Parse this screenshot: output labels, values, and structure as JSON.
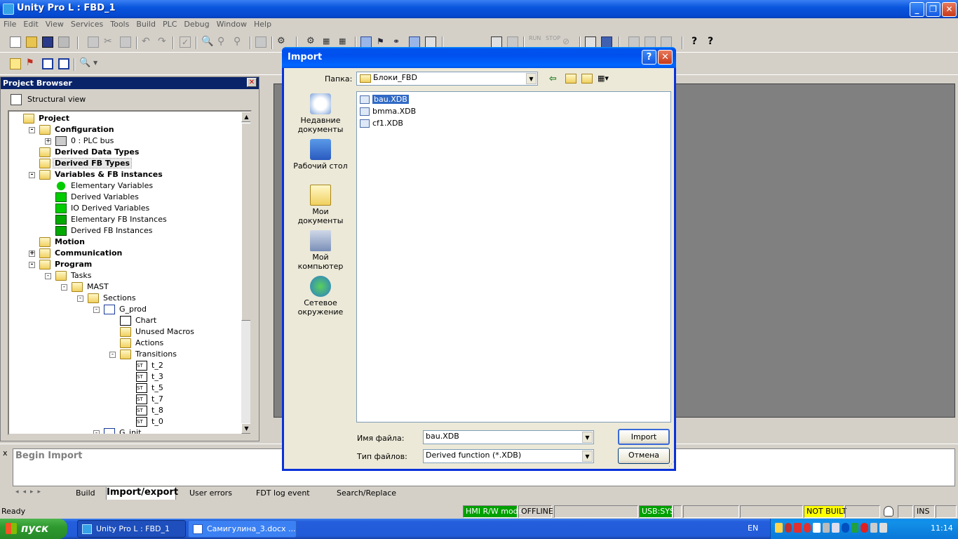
{
  "window": {
    "title": "Unity Pro L : FBD_1"
  },
  "menu": [
    "File",
    "Edit",
    "View",
    "Services",
    "Tools",
    "Build",
    "PLC",
    "Debug",
    "Window",
    "Help"
  ],
  "project_browser": {
    "title": "Project Browser",
    "view_label": "Structural view",
    "tree": [
      {
        "label": "Project",
        "bold": true
      },
      {
        "label": "Configuration",
        "bold": true
      },
      {
        "label": "0 : PLC bus",
        "bold": false
      },
      {
        "label": "Derived Data Types",
        "bold": true
      },
      {
        "label": "Derived FB Types",
        "bold": true
      },
      {
        "label": "Variables & FB instances",
        "bold": true
      },
      {
        "label": "Elementary Variables",
        "bold": false
      },
      {
        "label": "Derived Variables",
        "bold": false
      },
      {
        "label": "IO Derived Variables",
        "bold": false
      },
      {
        "label": "Elementary FB Instances",
        "bold": false
      },
      {
        "label": "Derived FB Instances",
        "bold": false
      },
      {
        "label": "Motion",
        "bold": true
      },
      {
        "label": "Communication",
        "bold": true
      },
      {
        "label": "Program",
        "bold": true
      },
      {
        "label": "Tasks",
        "bold": false
      },
      {
        "label": "MAST",
        "bold": false
      },
      {
        "label": "Sections",
        "bold": false
      },
      {
        "label": "G_prod",
        "bold": false
      },
      {
        "label": "Chart",
        "bold": false
      },
      {
        "label": "Unused Macros",
        "bold": false
      },
      {
        "label": "Actions",
        "bold": false
      },
      {
        "label": "Transitions",
        "bold": false
      },
      {
        "label": "t_2",
        "bold": false
      },
      {
        "label": "t_3",
        "bold": false
      },
      {
        "label": "t_5",
        "bold": false
      },
      {
        "label": "t_7",
        "bold": false
      },
      {
        "label": "t_8",
        "bold": false
      },
      {
        "label": "t_0",
        "bold": false
      },
      {
        "label": "G_init",
        "bold": false
      }
    ]
  },
  "dialog": {
    "title": "Import",
    "help_btn": "?",
    "close_btn": "✕",
    "folder_label": "Папка:",
    "folder_value": "Блоки_FBD",
    "places": [
      "Недавние документы",
      "Рабочий стол",
      "Мои документы",
      "Мой компьютер",
      "Сетевое окружение"
    ],
    "files": [
      "bau.XDB",
      "bmma.XDB",
      "cf1.XDB"
    ],
    "selected_file": "bau.XDB",
    "filename_label": "Имя файла:",
    "filename_value": "bau.XDB",
    "filetype_label": "Тип файлов:",
    "filetype_value": "Derived function  (*.XDB)",
    "import_btn": "Import",
    "cancel_btn": "Отмена"
  },
  "output": {
    "text": "Begin Import",
    "close": "x",
    "tabs": [
      "Build",
      "Import/export",
      "User errors",
      "FDT log event",
      "Search/Replace"
    ],
    "active_tab": "Import/export"
  },
  "status": {
    "ready": "Ready",
    "hmi": "HMI R/W mode",
    "offline": "OFFLINE",
    "usb": "USB:SYS",
    "built": "NOT BUILT",
    "ins": "INS"
  },
  "taskbar": {
    "start": "пуск",
    "tasks": [
      "Unity Pro L : FBD_1",
      "Самигулина_3.docx ..."
    ],
    "lang": "EN",
    "clock": "11:14"
  },
  "colors": {
    "title_blue": "#0a56dd",
    "tree_header": "#0a246a",
    "hmi_green": "#00a000",
    "not_built": "#ffff00",
    "workspace": "#808080",
    "start_green": "#2f9a2f"
  }
}
